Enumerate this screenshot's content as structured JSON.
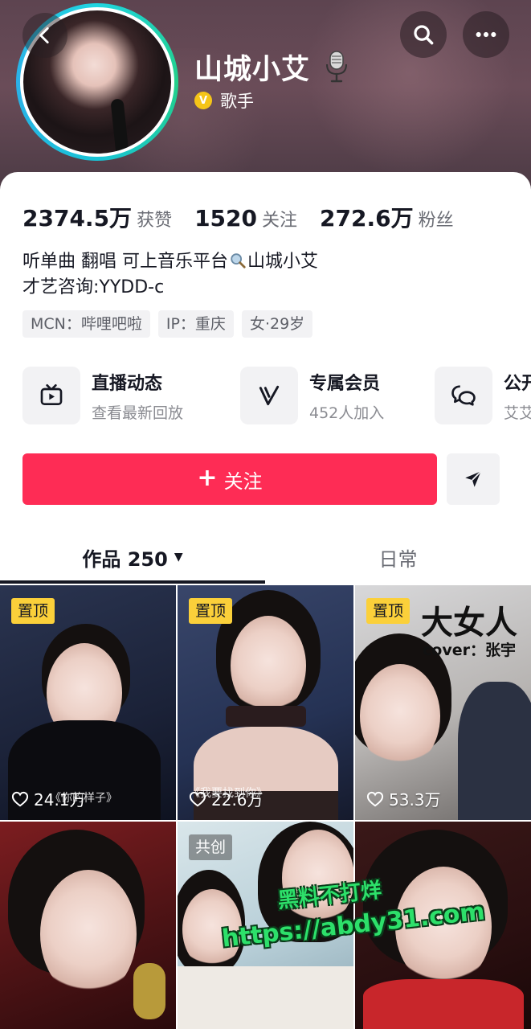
{
  "header": {
    "username": "山城小艾",
    "verify_badge": "V",
    "verify_label": "歌手",
    "back_icon": "chevron-left-icon",
    "search_icon": "search-icon",
    "more_icon": "more-icon"
  },
  "stats": [
    {
      "value": "2374.5万",
      "label": "获赞"
    },
    {
      "value": "1520",
      "label": "关注"
    },
    {
      "value": "272.6万",
      "label": "粉丝"
    }
  ],
  "bio": {
    "line1_prefix": "听单曲 翻唱 可上音乐平台",
    "line1_suffix": "山城小艾",
    "line2": "才艺咨询:YYDD-c"
  },
  "tags": [
    "MCN：哔哩吧啦",
    "IP：重庆",
    "女·29岁"
  ],
  "services": [
    {
      "title": "直播动态",
      "subtitle": "查看最新回放",
      "icon": "live-tv-icon"
    },
    {
      "title": "专属会员",
      "subtitle": "452人加入",
      "icon": "v-member-icon"
    },
    {
      "title": "公开",
      "subtitle": "艾艾",
      "icon": "chat-bubbles-icon"
    }
  ],
  "actions": {
    "follow_plus": "+",
    "follow_label": "关注",
    "share_icon": "send-icon"
  },
  "tabs": {
    "works_label": "作品 250",
    "works_caret": "▼",
    "daily_label": "日常"
  },
  "videos": [
    {
      "badge": "置顶",
      "likes": "24.1万",
      "caption": "《你的样子》"
    },
    {
      "badge": "置顶",
      "likes": "22.6万",
      "caption": "《我要找到你》"
    },
    {
      "badge": "置顶",
      "likes": "53.3万",
      "title": "大女人",
      "cover": "cover：张宇"
    },
    {
      "badge": ""
    },
    {
      "badge": "共创"
    },
    {
      "badge": ""
    }
  ],
  "watermark": {
    "line1": "黑料不打烊",
    "line2": "https://abdy31.com"
  },
  "colors": {
    "accent": "#fe2c55",
    "pin_badge": "#fbd03a",
    "watermark": "#2de06a"
  }
}
